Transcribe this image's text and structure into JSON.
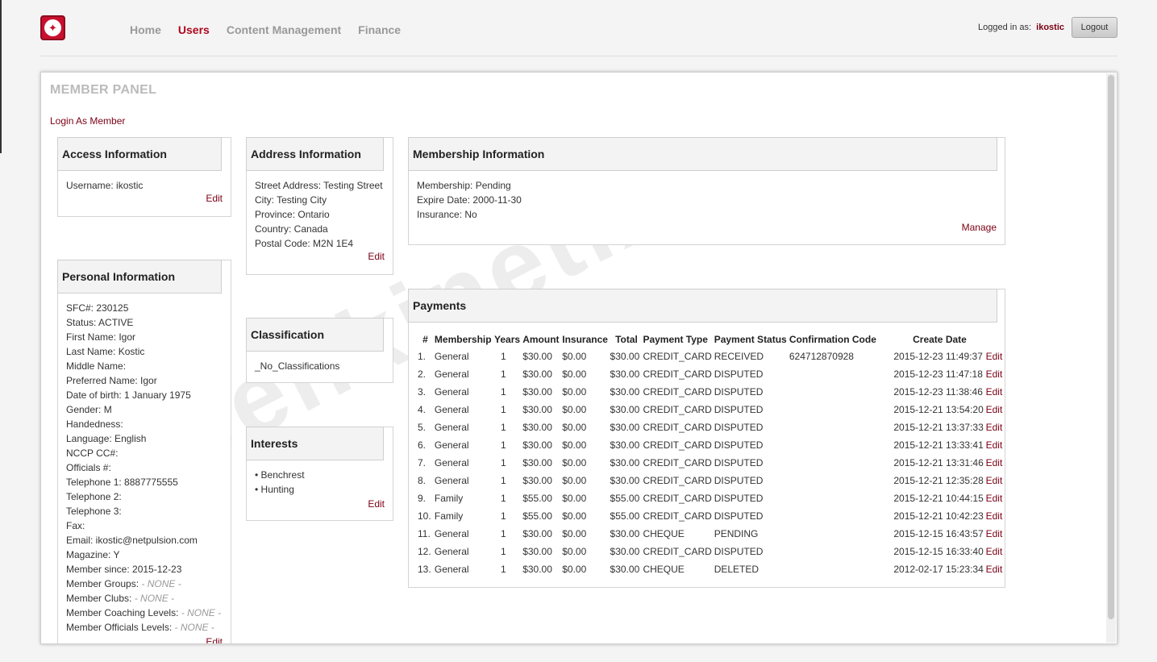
{
  "header": {
    "nav": [
      "Home",
      "Users",
      "Content Management",
      "Finance"
    ],
    "logged_in_label": "Logged in as:",
    "username": "ikostic",
    "logout_label": "Logout",
    "logo_icon": "maple-leaf-icon"
  },
  "panel": {
    "title": "MEMBER PANEL",
    "login_as_member": "Login As Member",
    "watermark": "openkinetix"
  },
  "access": {
    "title": "Access Information",
    "lines": [
      "Username: ikostic"
    ],
    "edit": "Edit"
  },
  "address": {
    "title": "Address Information",
    "lines": [
      "Street Address: Testing Street",
      "City: Testing City",
      "Province: Ontario",
      "Country: Canada",
      "Postal Code: M2N 1E4"
    ],
    "edit": "Edit"
  },
  "membership": {
    "title": "Membership Information",
    "lines": [
      "Membership: Pending",
      "Expire Date: 2000-11-30",
      "Insurance: No"
    ],
    "manage": "Manage"
  },
  "personal": {
    "title": "Personal Information",
    "lines": [
      "SFC#: 230125",
      "Status: ACTIVE",
      "First Name: Igor",
      "Last Name: Kostic",
      "Middle Name:",
      "Preferred Name: Igor",
      "Date of birth: 1 January 1975",
      "Gender: M",
      "Handedness:",
      "Language: English",
      "NCCP CC#:",
      "Officials #:",
      "Telephone 1: 8887775555",
      "Telephone 2:",
      "Telephone 3:",
      "Fax:",
      "Email: ikostic@netpulsion.com",
      "Magazine: Y",
      "Member since: 2015-12-23"
    ],
    "groups_label": "Member Groups:",
    "clubs_label": "Member Clubs:",
    "coaching_label": "Member Coaching Levels:",
    "officials_label": "Member Officials Levels:",
    "none_text": "- NONE -",
    "edit": "Edit"
  },
  "classification": {
    "title": "Classification",
    "lines": [
      "_No_Classifications"
    ]
  },
  "interests": {
    "title": "Interests",
    "items": [
      "• Benchrest",
      "• Hunting"
    ],
    "edit": "Edit"
  },
  "payments": {
    "title": "Payments",
    "columns": [
      "#",
      "Membership",
      "Years",
      "Amount",
      "Insurance",
      "Total",
      "Payment Type",
      "Payment Status",
      "Confirmation Code",
      "Create Date"
    ],
    "rows": [
      [
        "1.",
        "General",
        "1",
        "$30.00",
        "$0.00",
        "$30.00",
        "CREDIT_CARD",
        "RECEIVED",
        "624712870928",
        "2015-12-23 11:49:37",
        "Edit"
      ],
      [
        "2.",
        "General",
        "1",
        "$30.00",
        "$0.00",
        "$30.00",
        "CREDIT_CARD",
        "DISPUTED",
        "",
        "2015-12-23 11:47:18",
        "Edit"
      ],
      [
        "3.",
        "General",
        "1",
        "$30.00",
        "$0.00",
        "$30.00",
        "CREDIT_CARD",
        "DISPUTED",
        "",
        "2015-12-23 11:38:46",
        "Edit"
      ],
      [
        "4.",
        "General",
        "1",
        "$30.00",
        "$0.00",
        "$30.00",
        "CREDIT_CARD",
        "DISPUTED",
        "",
        "2015-12-21 13:54:20",
        "Edit"
      ],
      [
        "5.",
        "General",
        "1",
        "$30.00",
        "$0.00",
        "$30.00",
        "CREDIT_CARD",
        "DISPUTED",
        "",
        "2015-12-21 13:37:33",
        "Edit"
      ],
      [
        "6.",
        "General",
        "1",
        "$30.00",
        "$0.00",
        "$30.00",
        "CREDIT_CARD",
        "DISPUTED",
        "",
        "2015-12-21 13:33:41",
        "Edit"
      ],
      [
        "7.",
        "General",
        "1",
        "$30.00",
        "$0.00",
        "$30.00",
        "CREDIT_CARD",
        "DISPUTED",
        "",
        "2015-12-21 13:31:46",
        "Edit"
      ],
      [
        "8.",
        "General",
        "1",
        "$30.00",
        "$0.00",
        "$30.00",
        "CREDIT_CARD",
        "DISPUTED",
        "",
        "2015-12-21 12:35:28",
        "Edit"
      ],
      [
        "9.",
        "Family",
        "1",
        "$55.00",
        "$0.00",
        "$55.00",
        "CREDIT_CARD",
        "DISPUTED",
        "",
        "2015-12-21 10:44:15",
        "Edit"
      ],
      [
        "10.",
        "Family",
        "1",
        "$55.00",
        "$0.00",
        "$55.00",
        "CREDIT_CARD",
        "DISPUTED",
        "",
        "2015-12-21 10:42:23",
        "Edit"
      ],
      [
        "11.",
        "General",
        "1",
        "$30.00",
        "$0.00",
        "$30.00",
        "CHEQUE",
        "PENDING",
        "",
        "2015-12-15 16:43:57",
        "Edit"
      ],
      [
        "12.",
        "General",
        "1",
        "$30.00",
        "$0.00",
        "$30.00",
        "CREDIT_CARD",
        "DISPUTED",
        "",
        "2015-12-15 16:33:40",
        "Edit"
      ],
      [
        "13.",
        "General",
        "1",
        "$30.00",
        "$0.00",
        "$30.00",
        "CHEQUE",
        "DELETED",
        "",
        "2012-02-17 15:23:34",
        "Edit"
      ]
    ]
  }
}
